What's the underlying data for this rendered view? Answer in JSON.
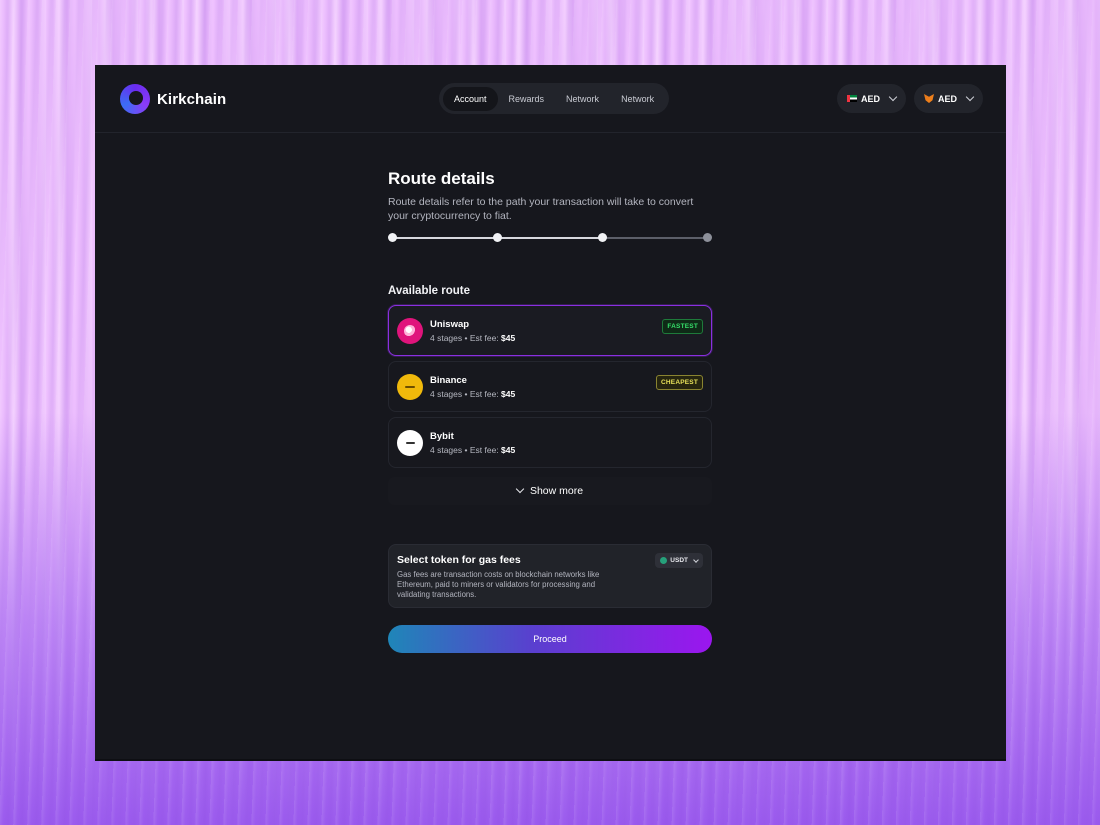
{
  "brand": {
    "name": "Kirkchain"
  },
  "nav": {
    "tabs": [
      "Account",
      "Rewards",
      "Network",
      "Network"
    ],
    "active_index": 0
  },
  "currency_selectors": [
    {
      "label": "AED",
      "icon": "uae-flag-icon"
    },
    {
      "label": "AED",
      "icon": "metamask-fox-icon"
    }
  ],
  "page": {
    "title": "Route details",
    "description": "Route details refer to the path your transaction will take to convert your cryptocurrency to fiat.",
    "progress": {
      "steps": 4,
      "completed": 3
    }
  },
  "routes": {
    "heading": "Available route",
    "items": [
      {
        "name": "Uniswap",
        "stages": "4 stages",
        "fee_label": "Est fee:",
        "fee": "$45",
        "badge": "FASTEST",
        "selected": true
      },
      {
        "name": "Binance",
        "stages": "4 stages",
        "fee_label": "Est fee:",
        "fee": "$45",
        "badge": "CHEAPEST",
        "selected": false
      },
      {
        "name": "Bybit",
        "stages": "4 stages",
        "fee_label": "Est fee:",
        "fee": "$45",
        "badge": "",
        "selected": false
      }
    ],
    "show_more": "Show more"
  },
  "gas": {
    "title": "Select token for gas fees",
    "description": "Gas fees are transaction costs on blockchain networks like Ethereum, paid to miners or validators for processing and validating transactions.",
    "token": "USDT"
  },
  "proceed_label": "Proceed",
  "colors": {
    "accent_purple": "#9b16ef",
    "accent_blue": "#1f86b8",
    "fastest_green": "#36e06a",
    "cheapest_yellow": "#e8e25a",
    "app_background": "#16171d"
  }
}
